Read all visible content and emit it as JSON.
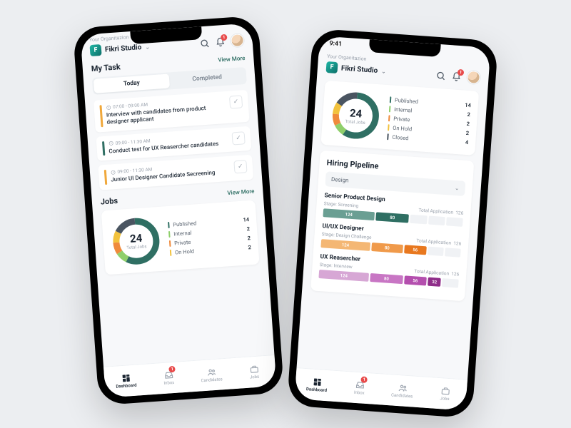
{
  "status_time": "9:41",
  "header": {
    "org_label": "Your Organitazion",
    "org_name": "Fikri Studio",
    "notif_count": "1"
  },
  "mytask": {
    "title": "My Task",
    "view_more": "View More",
    "tabs": {
      "today": "Today",
      "completed": "Completed"
    },
    "items": [
      {
        "time": "07:00 - 09:00 AM",
        "title": "Interview with candidates from product designer applicant",
        "accent": "#f0a83b"
      },
      {
        "time": "09:00 - 11:30 AM",
        "title": "Conduct test for UX Reasercher candidates",
        "accent": "#2f6f63"
      },
      {
        "time": "09:00 - 11:30 AM",
        "title": "Junior UI Designer Candidate Secreening",
        "accent": "#f0a83b"
      }
    ]
  },
  "jobs": {
    "title": "Jobs",
    "view_more": "View More"
  },
  "chart_data": {
    "type": "pie",
    "title": "Total Jobs",
    "total": 24,
    "series": [
      {
        "name": "Published",
        "value": 14,
        "color": "#2f6f63"
      },
      {
        "name": "Internal",
        "value": 2,
        "color": "#8fcf6b"
      },
      {
        "name": "Private",
        "value": 2,
        "color": "#ef8a3c"
      },
      {
        "name": "On Hold",
        "value": 2,
        "color": "#f2c23d"
      },
      {
        "name": "Closed",
        "value": 4,
        "color": "#4a5561"
      }
    ]
  },
  "pipeline": {
    "title": "Hiring Pipeline",
    "filter": "Design",
    "total_label": "Total Application",
    "stage_label": "Stage:",
    "items": [
      {
        "role": "Senior Product Design",
        "stage": "Screening",
        "total": 126,
        "segs": [
          {
            "v": 124,
            "c": "#6a9f93"
          },
          {
            "v": 80,
            "c": "#2f6f63"
          }
        ],
        "empties": 3,
        "palette": "teal"
      },
      {
        "role": "UI/UX Designer",
        "stage": "Design Challenge",
        "total": 126,
        "segs": [
          {
            "v": 124,
            "c": "#f4b774"
          },
          {
            "v": 80,
            "c": "#f09a4a"
          },
          {
            "v": 56,
            "c": "#e8781f"
          }
        ],
        "empties": 2,
        "palette": "orange"
      },
      {
        "role": "UX Reasercher",
        "stage": "Interview",
        "total": 126,
        "segs": [
          {
            "v": 124,
            "c": "#d7a7d5"
          },
          {
            "v": 80,
            "c": "#c876c4"
          },
          {
            "v": 56,
            "c": "#b44fae"
          },
          {
            "v": 32,
            "c": "#8f2e89"
          }
        ],
        "empties": 1,
        "palette": "purple"
      }
    ]
  },
  "tabbar": {
    "items": [
      {
        "label": "Dashboard",
        "active": true
      },
      {
        "label": "Inbox",
        "badge": "1"
      },
      {
        "label": "Candidates"
      },
      {
        "label": "Jobs"
      }
    ]
  }
}
